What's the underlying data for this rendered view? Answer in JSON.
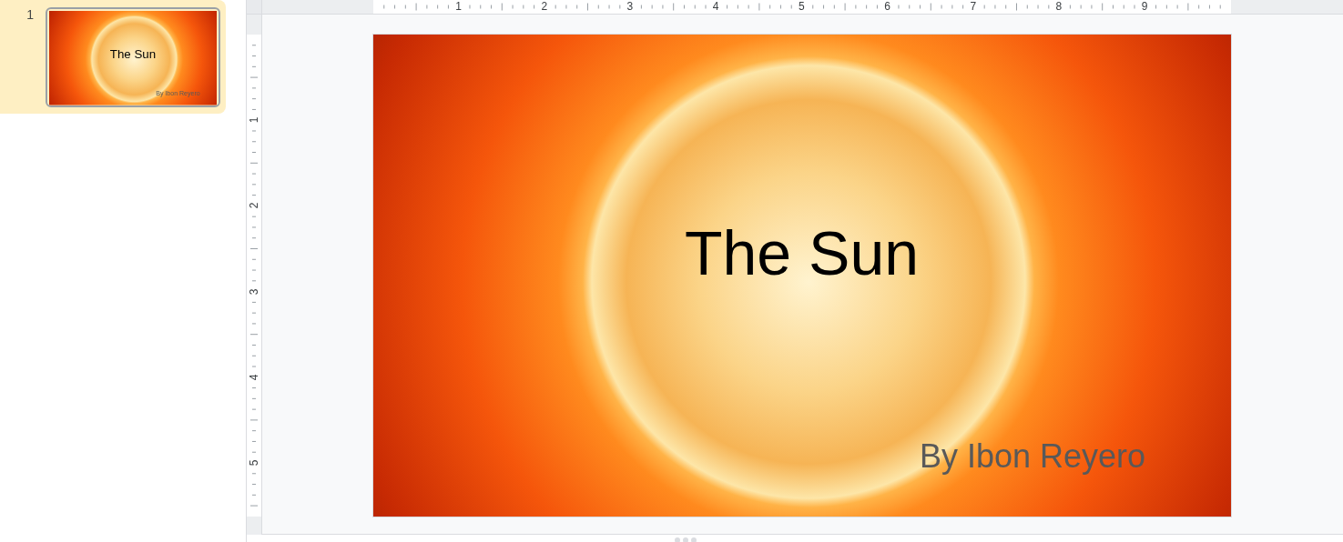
{
  "filmstrip": [
    {
      "number": "1",
      "selected": true,
      "title": "The Sun",
      "subtitle": "By Ibon Reyero"
    }
  ],
  "rulers": {
    "horizontal": [
      "1",
      "2",
      "3",
      "4",
      "5",
      "6",
      "7",
      "8",
      "9"
    ],
    "vertical": [
      "1",
      "2",
      "3",
      "4",
      "5"
    ]
  },
  "slide": {
    "title": "The Sun",
    "subtitle": "By Ibon Reyero"
  }
}
